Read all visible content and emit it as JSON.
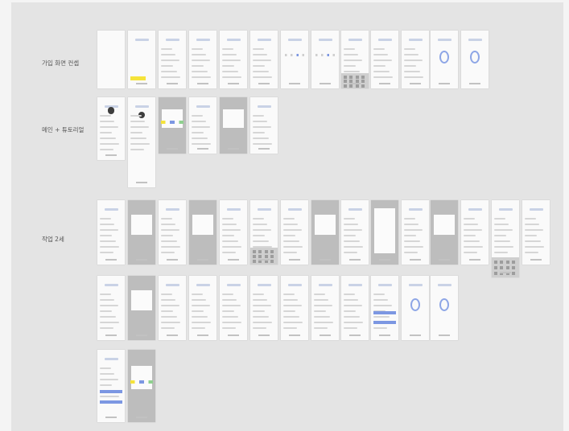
{
  "sections": [
    {
      "label": "가입 화면 컨셉"
    },
    {
      "label": "메인 + 튜토리얼"
    },
    {
      "label": "작업 2세"
    }
  ]
}
